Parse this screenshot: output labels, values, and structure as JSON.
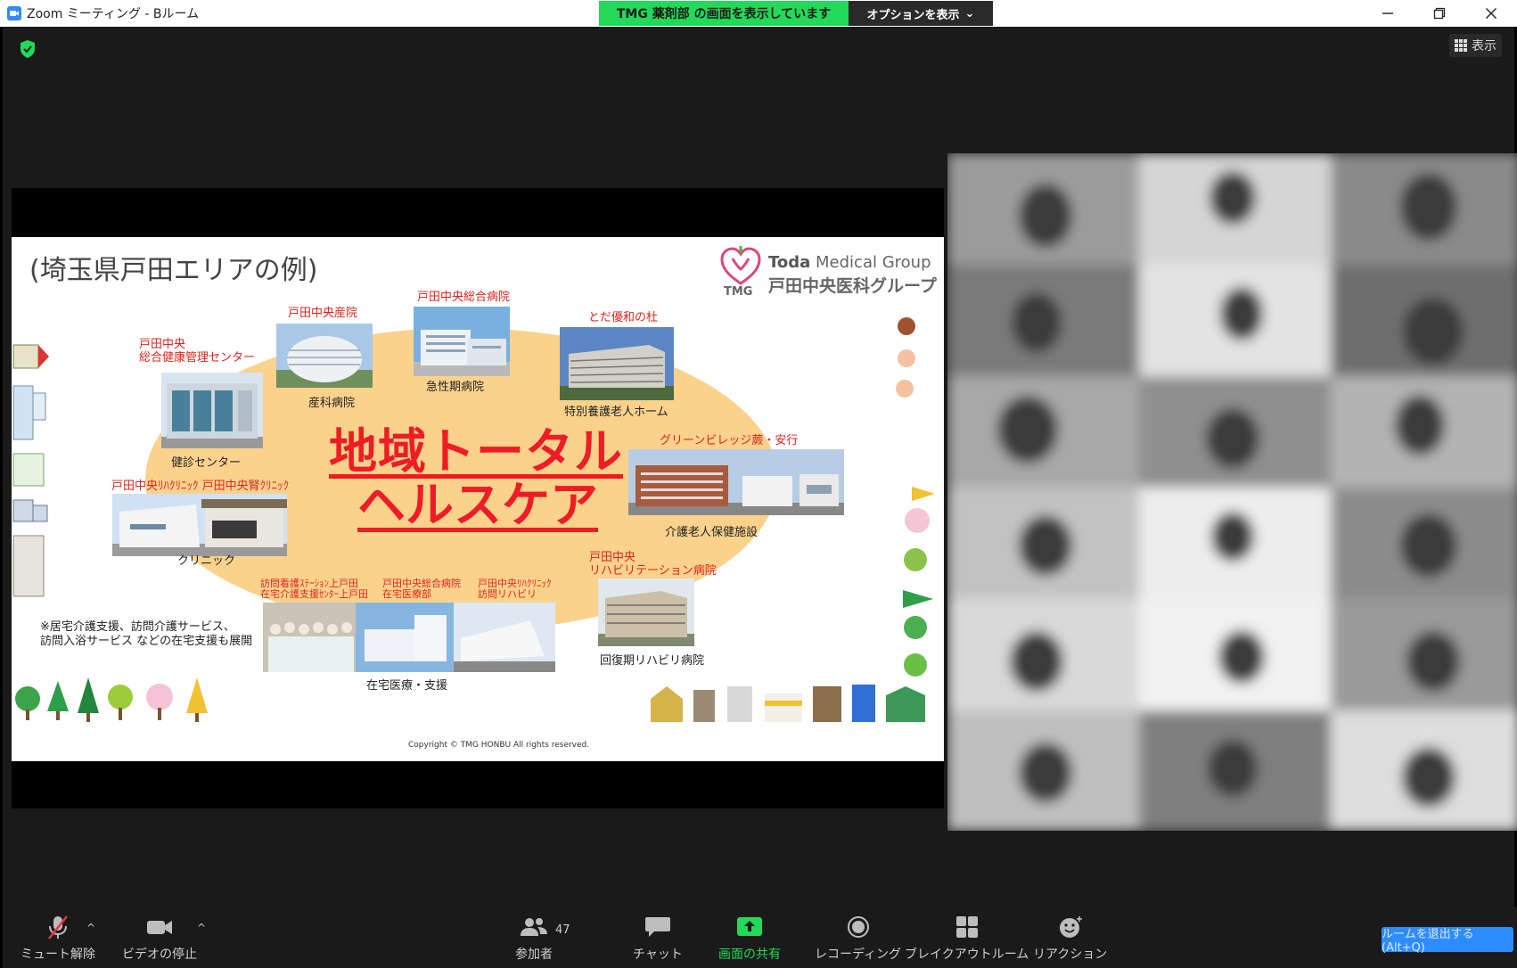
{
  "window": {
    "title": "Zoom ミーティング - Bルーム",
    "share_banner": "TMG 薬剤部 の画面を表示しています",
    "options_label": "オプションを表示"
  },
  "meeting": {
    "view_label": "表示",
    "leave_hint": "ルームを退出する (Alt+Q)"
  },
  "slide": {
    "title": "(埼玉県戸田エリアの例)",
    "logo_en_bold": "Toda",
    "logo_en_rest": " Medical Group",
    "logo_jp": "戸田中央医科グループ",
    "logo_tmg": "TMG",
    "center_line1": "地域トータル",
    "center_line2": "ヘルスケア",
    "labels": {
      "sanka_red": "戸田中央産院",
      "sanka": "産科病院",
      "sogo_red": "戸田中央総合病院",
      "kyusei": "急性期病院",
      "yuwa_red": "とだ優和の杜",
      "tokuyo": "特別養護老人ホーム",
      "kenshin_red1": "戸田中央",
      "kenshin_red2": "総合健康管理センター",
      "kenshin": "健診センター",
      "green_red": "グリーンビレッジ蕨・安行",
      "roken": "介護老人保健施設",
      "clinic_red": "戸田中央ﾘﾊｸﾘﾆｯｸ 戸田中央腎ｸﾘﾆｯｸ",
      "clinic": "クリニック",
      "reha_red1": "戸田中央",
      "reha_red2": "リハビリテーション病院",
      "kaifuku": "回復期リハビリ病院",
      "houmon_red1": "訪問看護ｽﾃｰｼｮﾝ上戸田",
      "houmon_red2": "在宅介護支援ｾﾝﾀｰ上戸田",
      "zaitaku_red1": "戸田中央総合病院",
      "zaitaku_red2": "在宅医療部",
      "rihaclinic_red1": "戸田中央ﾘﾊｸﾘﾆｯｸ",
      "rihaclinic_red2": "訪問リハビリ",
      "zaitaku": "在宅医療・支援"
    },
    "note_line1": "※居宅介護支援、訪問介護サービス、",
    "note_line2": "訪問入浴サービス などの在宅支援も展開",
    "copyright": "Copyright © TMG HONBU All rights reserved."
  },
  "toolbar": {
    "mute": "ミュート解除",
    "video": "ビデオの停止",
    "participants": "参加者",
    "participants_count": "47",
    "chat": "チャット",
    "share": "画面の共有",
    "record": "レコーディング",
    "breakout": "ブレイクアウトルーム",
    "reactions": "リアクション"
  },
  "colors": {
    "share_green": "#23d959",
    "accent_blue": "#2d8cff",
    "slide_red": "#ee1c25",
    "ellipse": "#fbd28c"
  }
}
